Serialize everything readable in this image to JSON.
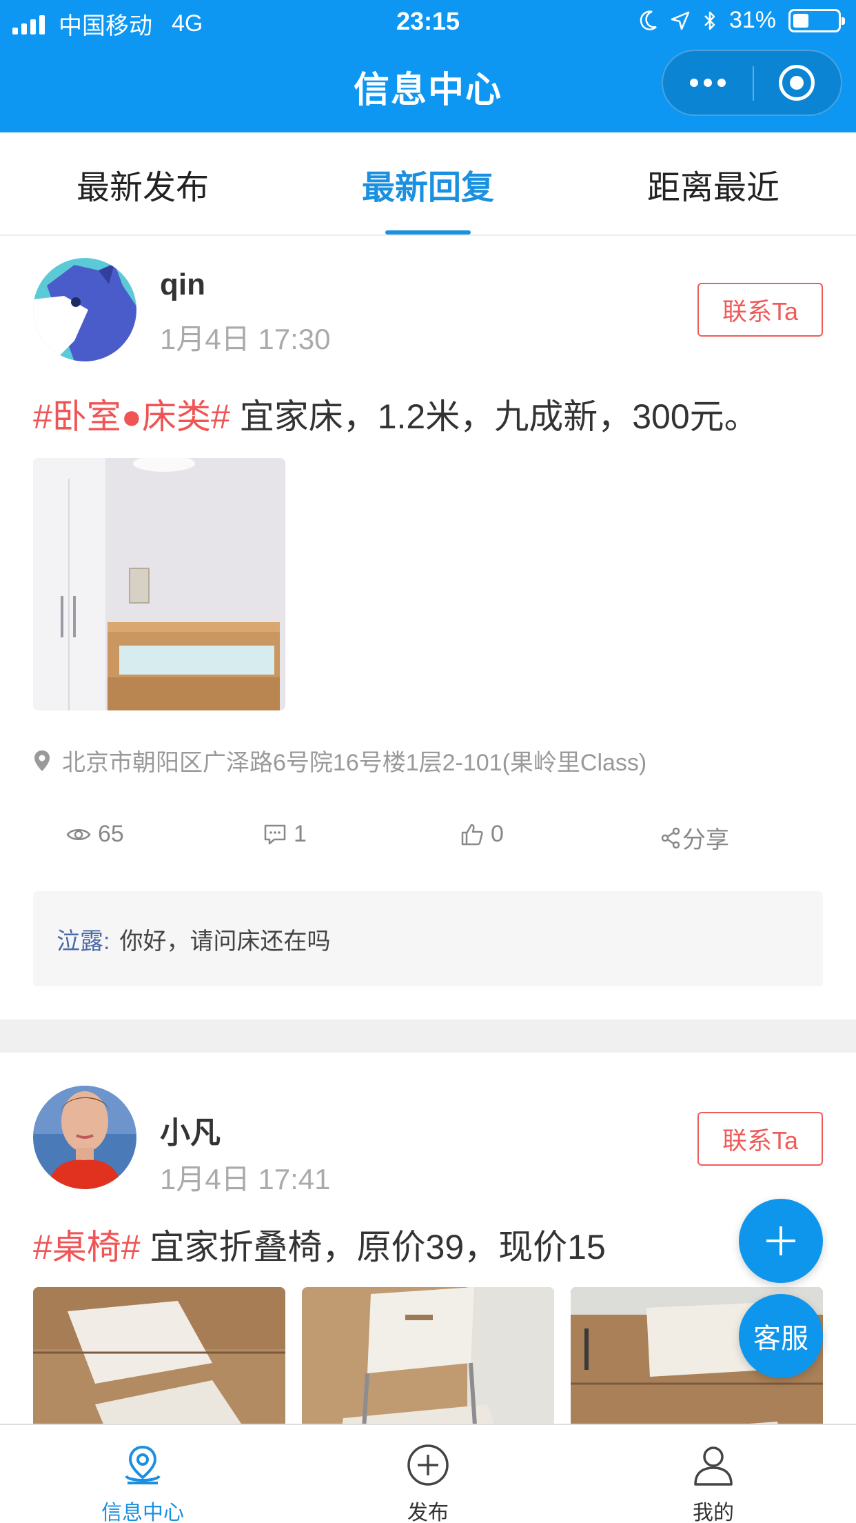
{
  "status_bar": {
    "carrier": "中国移动",
    "network": "4G",
    "time": "23:15",
    "battery": "31%"
  },
  "header": {
    "title": "信息中心"
  },
  "tabs": [
    {
      "label": "最新发布",
      "active": false
    },
    {
      "label": "最新回复",
      "active": true
    },
    {
      "label": "距离最近",
      "active": false
    }
  ],
  "posts": [
    {
      "username": "qin",
      "time": "1月4日 17:30",
      "contact_label": "联系Ta",
      "tag": "#卧室●床类#",
      "text": " 宜家床，1.2米，九成新，300元。",
      "location": "北京市朝阳区广泽路6号院16号楼1层2-101(果岭里Class)",
      "views": "65",
      "comments": "1",
      "likes": "0",
      "share_label": "分享",
      "comment": {
        "author": "泣露:",
        "text": "你好，请问床还在吗"
      }
    },
    {
      "username": "小凡",
      "time": "1月4日 17:41",
      "contact_label": "联系Ta",
      "tag": "#桌椅#",
      "text": " 宜家折叠椅，原价39，现价15"
    }
  ],
  "fab": {
    "service_label": "客服"
  },
  "bottom_nav": [
    {
      "label": "信息中心",
      "icon": "location-icon",
      "active": true
    },
    {
      "label": "发布",
      "icon": "plus-circle-icon",
      "active": false
    },
    {
      "label": "我的",
      "icon": "user-icon",
      "active": false
    }
  ],
  "colors": {
    "primary": "#0d97f2",
    "accent_red": "#f05454",
    "active_tab": "#1a90e0"
  }
}
